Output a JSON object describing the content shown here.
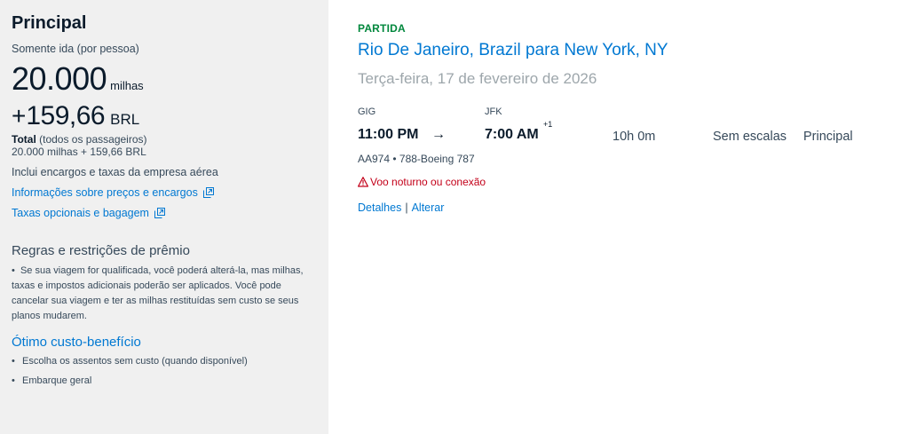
{
  "summary": {
    "cabin": "Principal",
    "trip_type": "Somente ida (por pessoa)",
    "miles": "20.000",
    "miles_unit": "milhas",
    "plus": "+",
    "price": "159,66",
    "currency": "BRL",
    "total_label": "Total",
    "total_note": " (todos os passageiros)",
    "total_amount": "20.000 milhas + 159,66 BRL",
    "includes": "Inclui encargos e taxas da empresa aérea",
    "pricing_link": "Informações sobre preços e encargos",
    "bag_link": "Taxas opcionais e bagagem"
  },
  "rules": {
    "title": "Regras e restrições de prêmio",
    "text": "Se sua viagem for qualificada, você poderá alterá-la, mas milhas, taxas e impostos adicionais poderão ser aplicados. Você pode cancelar sua viagem e ter as milhas restituídas sem custo se seus planos mudarem."
  },
  "value": {
    "title": "Ótimo custo-benefício",
    "bullets": [
      "Escolha os assentos sem custo (quando disponível)",
      "Embarque geral"
    ]
  },
  "flight": {
    "label": "PARTIDA",
    "route": "Rio De Janeiro, Brazil para New York, NY",
    "date": "Terça-feira, 17 de fevereiro de 2026",
    "origin_code": "GIG",
    "dest_code": "JFK",
    "depart_time": "11:00 PM",
    "arrow": "→",
    "arrive_time": "7:00 AM",
    "plus_day": "+1",
    "duration": "10h 0m",
    "stops": "Sem escalas",
    "cabin": "Principal",
    "flight_info": "AA974 • 788-Boeing 787",
    "warning": "Voo noturno ou conexão",
    "details_link": "Detalhes",
    "separator": "|",
    "change_link": "Alterar"
  },
  "colors": {
    "link": "#0078d2",
    "green": "#00873c",
    "warning": "#c30019",
    "sidebar_bg": "#f0f0f0"
  }
}
